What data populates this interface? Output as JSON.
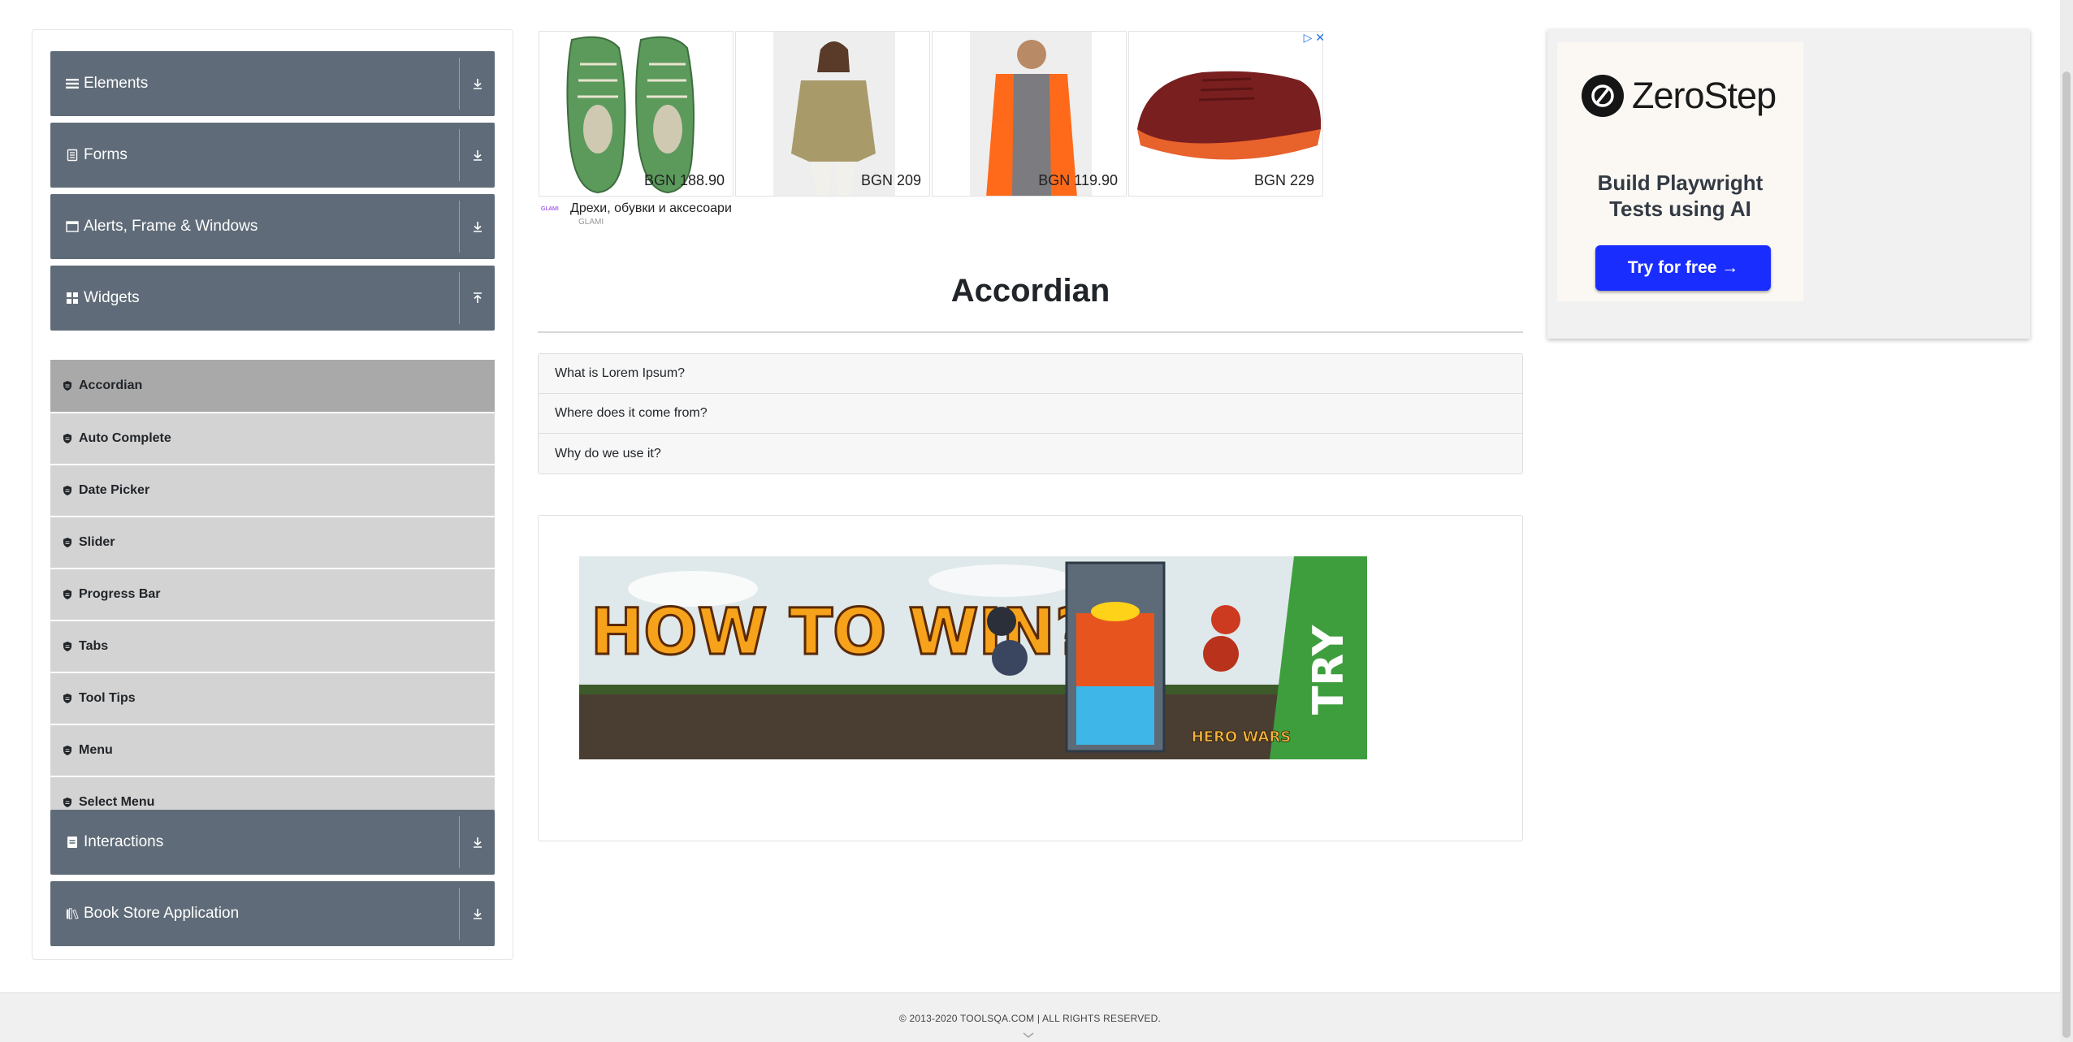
{
  "sidebar": {
    "groups": [
      {
        "label": "Elements",
        "icon": "bars-icon"
      },
      {
        "label": "Forms",
        "icon": "form-icon"
      },
      {
        "label": "Alerts, Frame & Windows",
        "icon": "window-icon"
      },
      {
        "label": "Widgets",
        "icon": "widgets-icon"
      },
      {
        "label": "Interactions",
        "icon": "interactions-icon"
      },
      {
        "label": "Book Store Application",
        "icon": "book-store-icon"
      }
    ],
    "widget_items": [
      "Accordian",
      "Auto Complete",
      "Date Picker",
      "Slider",
      "Progress Bar",
      "Tabs",
      "Tool Tips",
      "Menu",
      "Select Menu"
    ],
    "active_item": "Accordian"
  },
  "top_ad": {
    "products": [
      {
        "price": "BGN 188.90",
        "image": "green-sneakers"
      },
      {
        "price": "BGN 209",
        "image": "khaki-jacket-woman"
      },
      {
        "price": "BGN 119.90",
        "image": "orange-jacket-man"
      },
      {
        "price": "BGN 229",
        "image": "burgundy-running-shoe"
      }
    ],
    "brand_logo": "GLAMI",
    "title": "Дрехи, обувки и аксесоари",
    "subtitle": "GLAMI"
  },
  "main": {
    "title": "Accordian",
    "sections": [
      "What is Lorem Ipsum?",
      "Where does it come from?",
      "Why do we use it?"
    ]
  },
  "game_ad": {
    "headline": "HOW TO WIN?",
    "cta": "TRY",
    "brand": "HERO WARS"
  },
  "right_ad": {
    "brand": "ZeroStep",
    "line1": "Build Playwright",
    "line2": "Tests using AI",
    "button": "Try for free →"
  },
  "footer": {
    "text": "© 2013-2020 TOOLSQA.COM | ALL RIGHTS RESERVED."
  },
  "colors": {
    "group_header": "#5f6b78",
    "menu_item": "#d3d3d3",
    "menu_item_active": "#a9a9a9",
    "cta_blue": "#1a2dff"
  }
}
